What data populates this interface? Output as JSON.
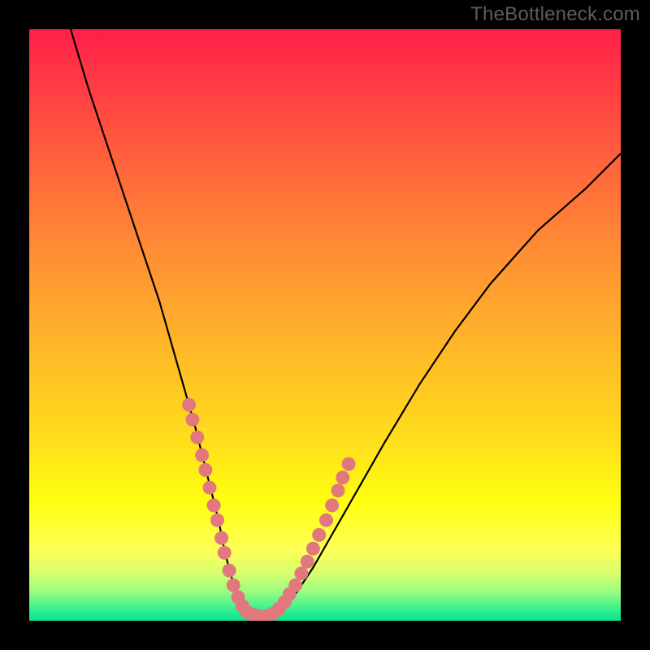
{
  "watermark": "TheBottleneck.com",
  "chart_data": {
    "type": "line",
    "title": "",
    "xlabel": "",
    "ylabel": "",
    "xlim": [
      0,
      100
    ],
    "ylim": [
      0,
      100
    ],
    "series": [
      {
        "name": "main-curve",
        "color": "#000000",
        "x": [
          7,
          10,
          14,
          18,
          22,
          26,
          28,
          30,
          32,
          33,
          34,
          35,
          36,
          37,
          39,
          41,
          43,
          45,
          48,
          52,
          56,
          60,
          66,
          72,
          78,
          86,
          94,
          100
        ],
        "y": [
          100,
          90,
          78,
          66,
          54,
          40,
          33,
          25,
          17,
          12,
          8,
          5,
          2.5,
          1.2,
          0.6,
          0.8,
          2,
          4.5,
          9,
          16,
          23,
          30,
          40,
          49,
          57,
          66,
          73,
          79
        ]
      },
      {
        "name": "marker-dots",
        "color": "#e2787e",
        "x": [
          27.0,
          27.6,
          28.4,
          29.2,
          29.8,
          30.5,
          31.2,
          31.8,
          32.5,
          33.0,
          33.8,
          34.5,
          35.3,
          36.0,
          36.8,
          37.8,
          38.8,
          40.2,
          41.2,
          42.2,
          43.2,
          44.0,
          45.0,
          46.0,
          47.0,
          48.0,
          49.0,
          50.2,
          51.2,
          52.2,
          53.0,
          54.0
        ],
        "y": [
          36.5,
          34.0,
          31.0,
          28.0,
          25.5,
          22.5,
          19.5,
          17.0,
          14.0,
          11.5,
          8.5,
          6.0,
          4.0,
          2.5,
          1.5,
          1.0,
          0.8,
          0.8,
          1.2,
          2.0,
          3.2,
          4.5,
          6.0,
          8.0,
          10.0,
          12.2,
          14.5,
          17.0,
          19.5,
          22.0,
          24.2,
          26.5
        ]
      }
    ],
    "background_gradient": {
      "top": "#ff1f47",
      "mid": "#ffe21a",
      "bottom": "#0fe493"
    }
  },
  "colors": {
    "frame": "#000000",
    "watermark": "#5d5d5d",
    "curve": "#000000",
    "dots": "#e2787e"
  }
}
